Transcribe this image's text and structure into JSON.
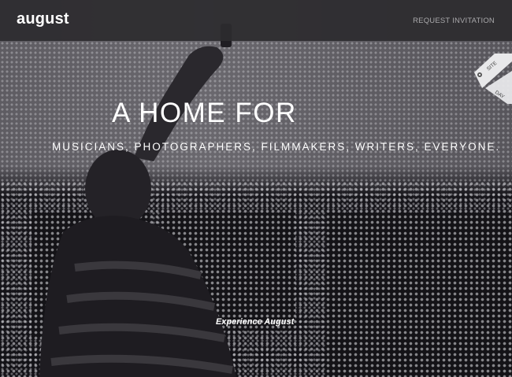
{
  "header": {
    "logo_text": "august",
    "request_invitation_label": "REQUEST INVITATION"
  },
  "hero": {
    "headline": "A HOME FOR",
    "tagline": "MUSICIANS, PHOTOGRAPHERS, FILMMAKERS, WRITERS, EVERYONE.",
    "cta_label": "Experience August"
  },
  "ribbon": {
    "line1": "SITE",
    "line2": "DAY",
    "icon": "gear-icon"
  },
  "colors": {
    "topbar": "#2c2b2f",
    "text": "#ffffff",
    "nav_link": "#a9a8ab"
  }
}
